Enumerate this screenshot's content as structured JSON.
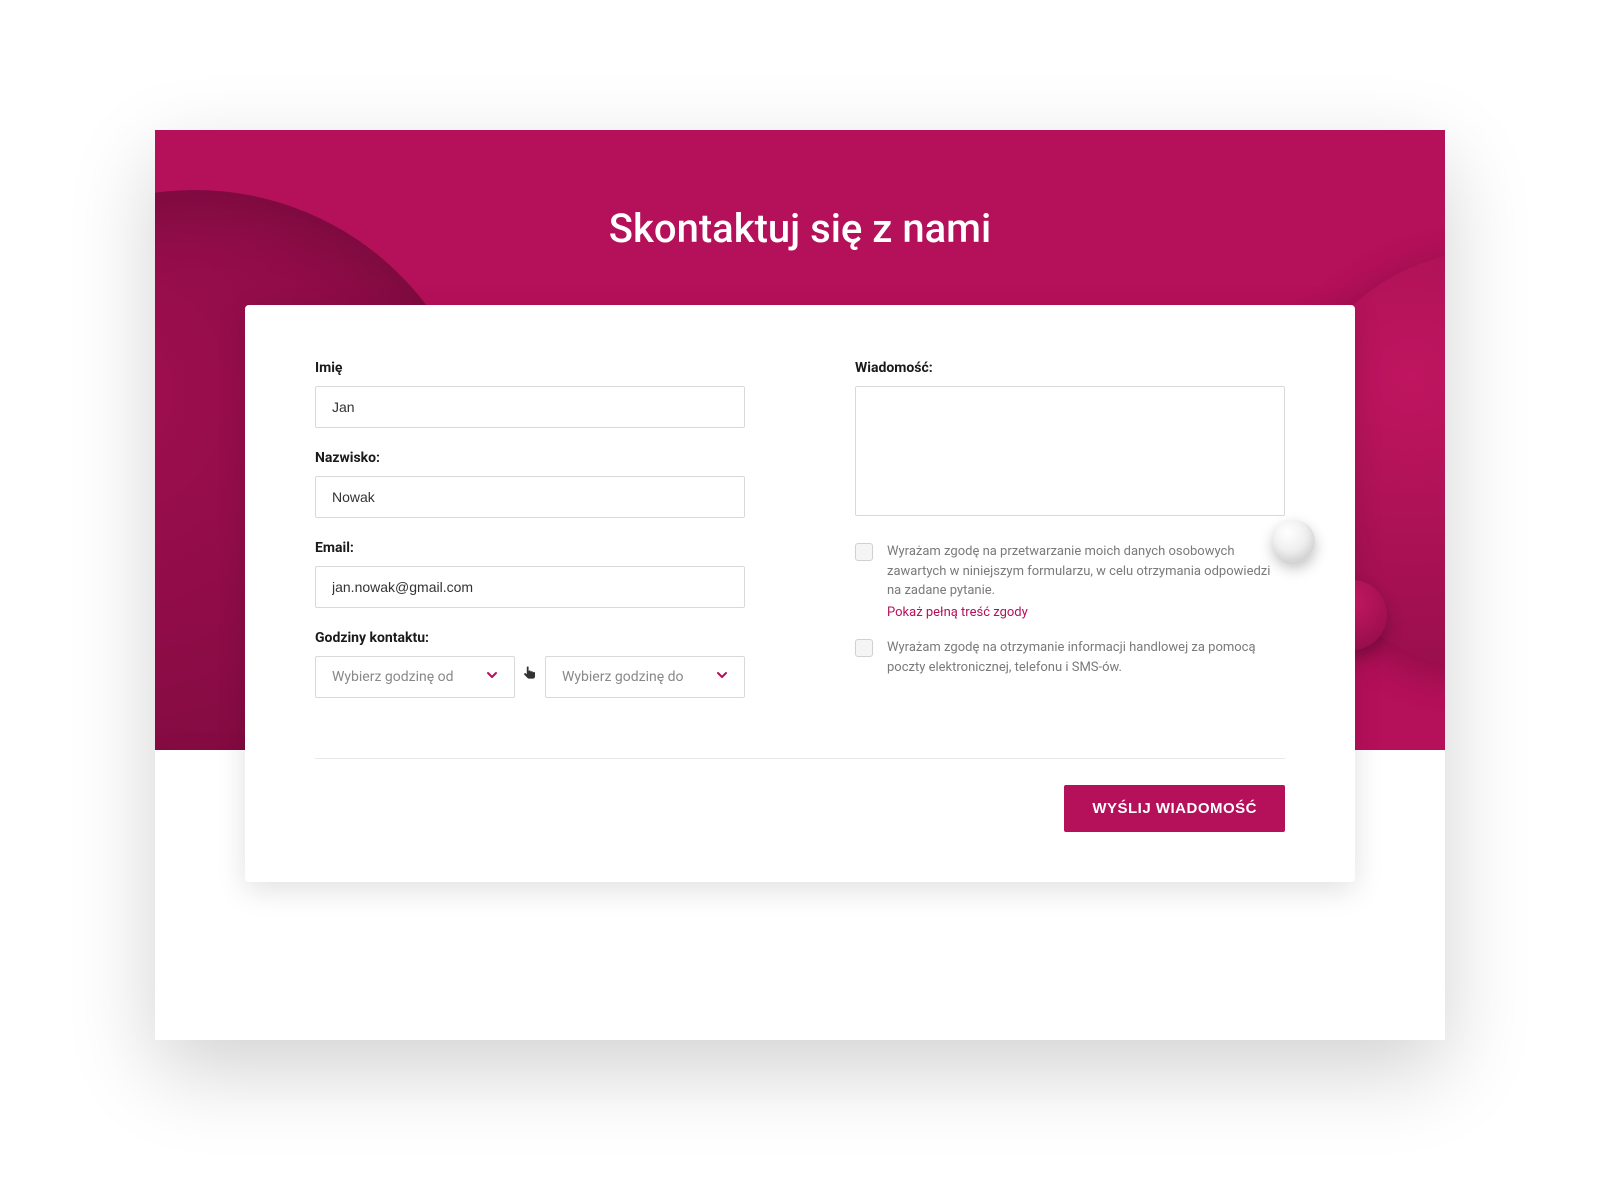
{
  "header": {
    "title": "Skontaktuj się z nami"
  },
  "form": {
    "left": {
      "firstName": {
        "label": "Imię",
        "value": "Jan"
      },
      "lastName": {
        "label": "Nazwisko:",
        "value": "Nowak"
      },
      "email": {
        "label": "Email:",
        "value": "jan.nowak@gmail.com"
      },
      "contactHours": {
        "label": "Godziny kontaktu:",
        "from": "Wybierz godzinę od",
        "to": "Wybierz godzinę do"
      }
    },
    "right": {
      "message": {
        "label": "Wiadomość:",
        "value": ""
      },
      "consent1": {
        "text": "Wyrażam zgodę na przetwarzanie moich danych osobowych zawartych w niniejszym formularzu, w celu otrzymania odpowiedzi na zadane pytanie.",
        "link": "Pokaż pełną treść zgody"
      },
      "consent2": {
        "text": "Wyrażam zgodę na otrzymanie informacji handlowej za pomocą poczty elektronicznej, telefonu i SMS-ów."
      }
    },
    "submit": "WYŚLIJ WIADOMOŚĆ"
  },
  "colors": {
    "brand": "#b5105a"
  }
}
